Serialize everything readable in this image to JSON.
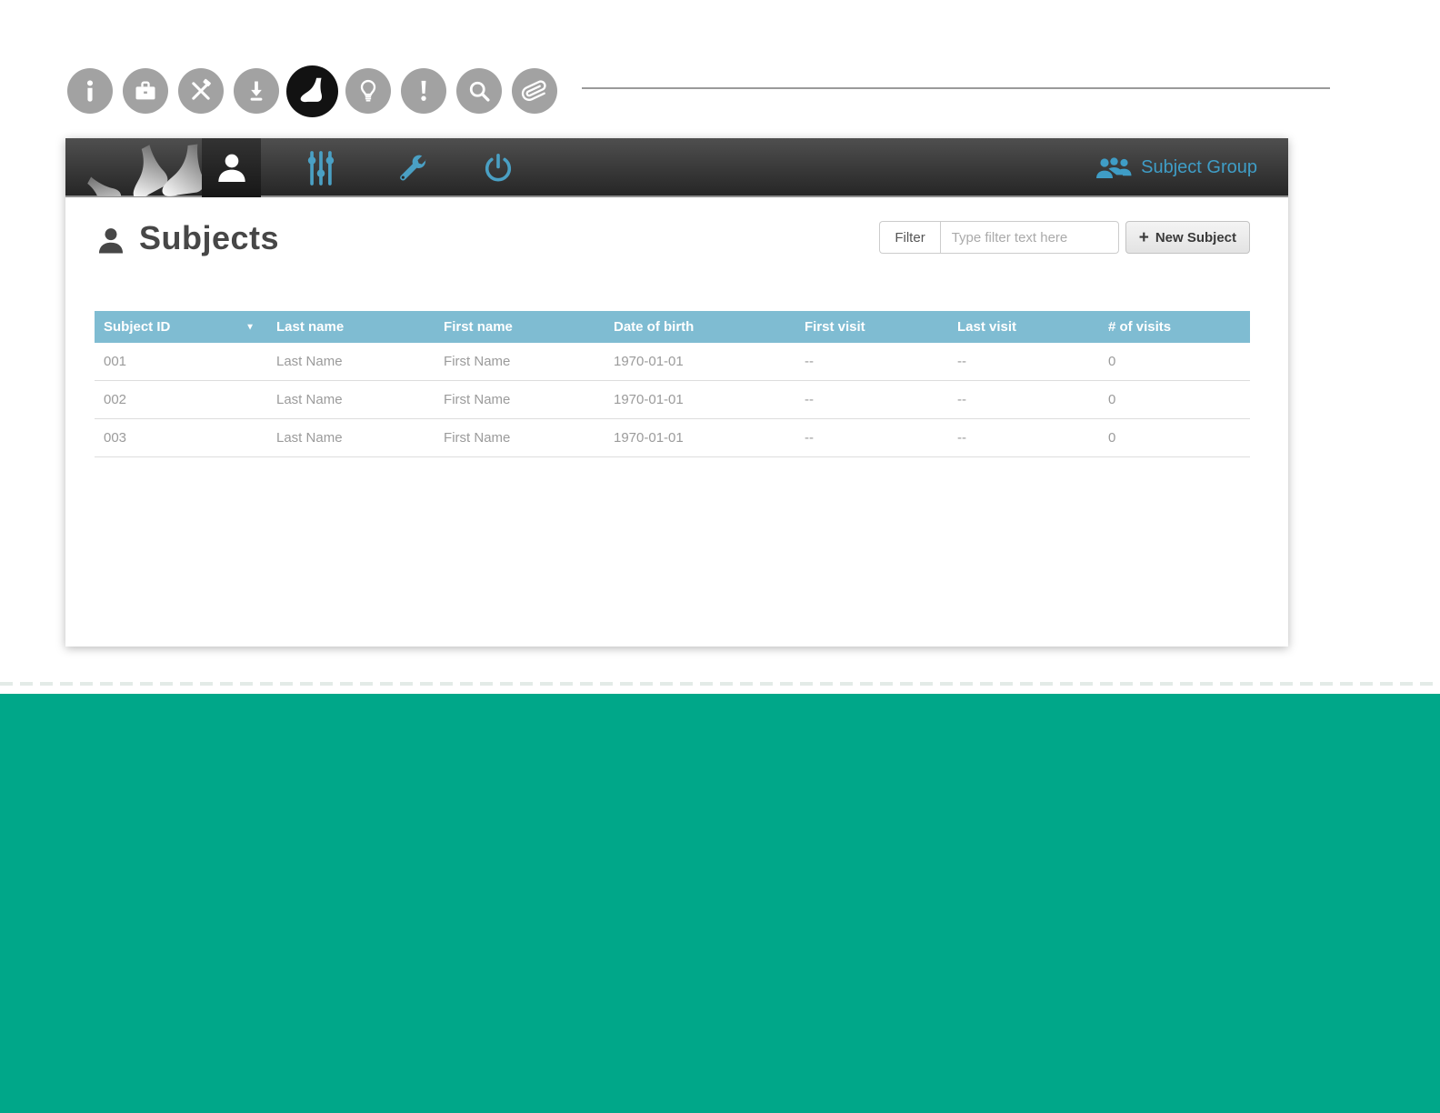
{
  "toolbar": {
    "icons": [
      {
        "name": "info-icon"
      },
      {
        "name": "briefcase-icon"
      },
      {
        "name": "tools-icon"
      },
      {
        "name": "download-icon"
      },
      {
        "name": "foot-icon",
        "active": true
      },
      {
        "name": "lightbulb-icon"
      },
      {
        "name": "exclamation-icon"
      },
      {
        "name": "search-icon"
      },
      {
        "name": "paperclip-icon"
      }
    ]
  },
  "navbar": {
    "tabs": [
      {
        "name": "subjects",
        "icon": "person-icon",
        "active": true
      },
      {
        "name": "measurement-settings",
        "icon": "sliders-icon"
      },
      {
        "name": "tools",
        "icon": "wrench-icon"
      },
      {
        "name": "power",
        "icon": "power-icon"
      }
    ],
    "subject_group_label": "Subject Group"
  },
  "page": {
    "title": "Subjects"
  },
  "filter": {
    "label": "Filter",
    "placeholder": "Type filter text here"
  },
  "actions": {
    "new_subject_label": "New Subject",
    "plus_glyph": "+"
  },
  "table": {
    "columns": [
      "Subject ID",
      "Last name",
      "First name",
      "Date of birth",
      "First visit",
      "Last visit",
      "# of visits"
    ],
    "sorted_column": "Subject ID",
    "sort_indicator": "▼",
    "rows": [
      [
        "001",
        "Last Name",
        "First Name",
        "1970-01-01",
        "--",
        "--",
        "0"
      ],
      [
        "002",
        "Last Name",
        "First Name",
        "1970-01-01",
        "--",
        "--",
        "0"
      ],
      [
        "003",
        "Last Name",
        "First Name",
        "1970-01-01",
        "--",
        "--",
        "0"
      ]
    ]
  },
  "colors": {
    "accent_blue": "#4aa0c4",
    "table_header_blue": "#7fbcd2",
    "footer_teal": "#00a789",
    "navbar_dark": "#2a2a2a"
  }
}
